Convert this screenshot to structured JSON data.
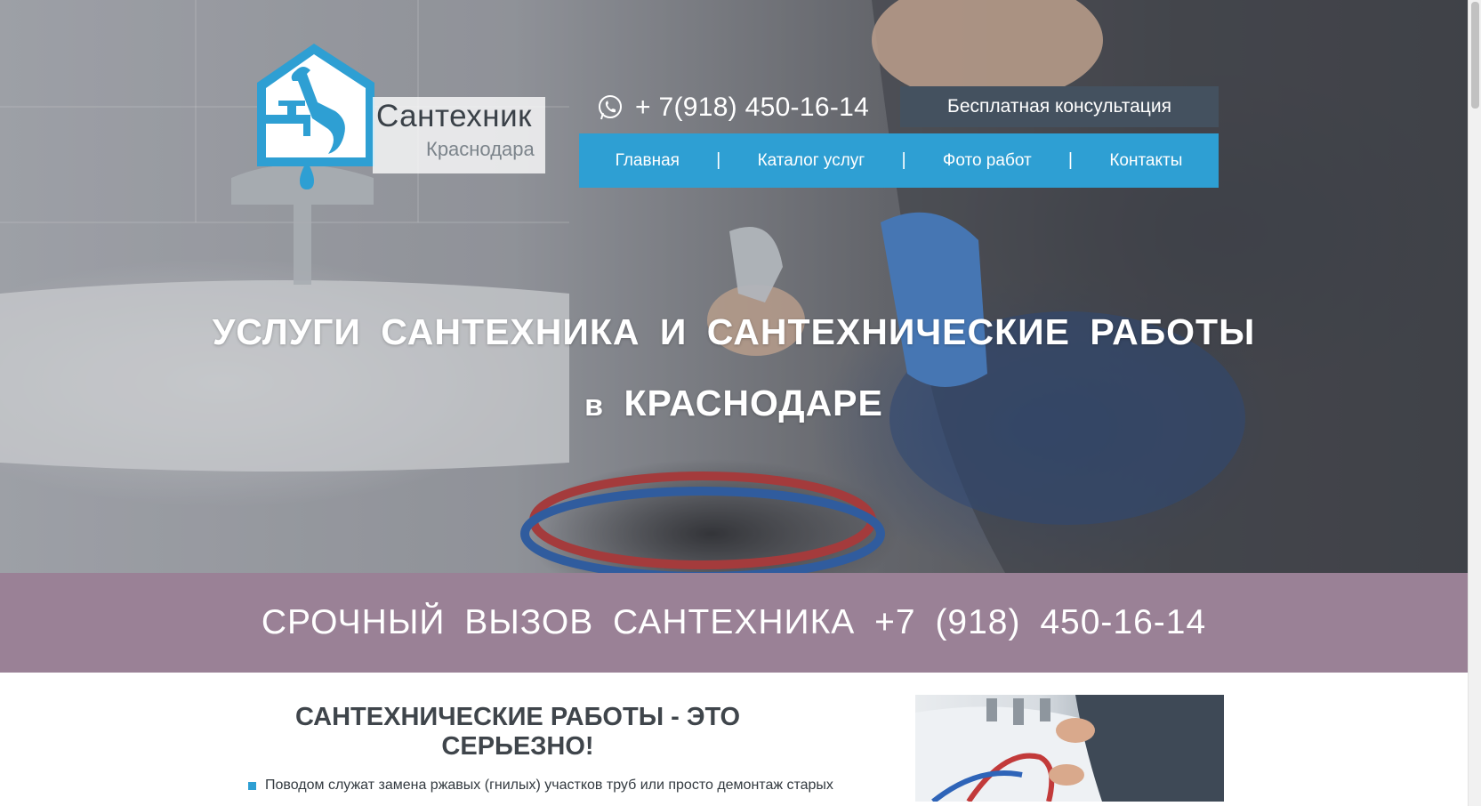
{
  "logo": {
    "title": "Сантехник",
    "subtitle": "Краснодара",
    "accent_color": "#2e9fd3"
  },
  "header": {
    "phone_icon": "whatsapp-icon",
    "phone": "+ 7(918) 450-16-14",
    "cta_label": "Бесплатная консультация",
    "cta_color": "#44515f"
  },
  "nav": {
    "color": "#2e9fd3",
    "items": [
      {
        "label": "Главная"
      },
      {
        "label": "Каталог услуг"
      },
      {
        "label": "Фото работ"
      },
      {
        "label": "Контакты"
      }
    ],
    "separator": "|"
  },
  "hero": {
    "line1": "УСЛУГИ САНТЕХНИКА И САНТЕХНИЧЕСКИЕ РАБОТЫ",
    "line2_prefix": "в",
    "line2_main": "КРАСНОДАРЕ"
  },
  "urgent": {
    "text": "СРОЧНЫЙ ВЫЗОВ САНТЕХНИКА +7 (918) 450-16-14",
    "color": "#9a8196"
  },
  "content": {
    "title": "САНТЕХНИЧЕСКИЕ РАБОТЫ - ЭТО СЕРЬЕЗНО!",
    "bullets": [
      "Поводом служат замена ржавых (гнилых) участков труб или просто демонтаж старых"
    ]
  }
}
